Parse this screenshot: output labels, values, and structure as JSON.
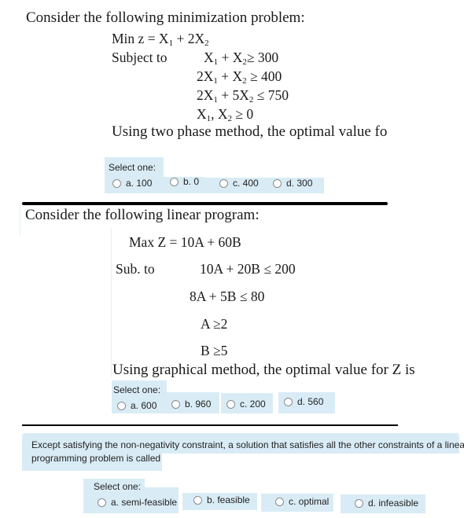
{
  "questions": [
    {
      "intro": "Consider the following minimization problem:",
      "objective": {
        "prefix": "Min z = X",
        "s1": "1",
        "mid": " + 2X",
        "s2": "2"
      },
      "subject_to_label": "Subject to",
      "constraints": [
        {
          "a": "X",
          "s1": "1",
          "b": " + X",
          "s2": "2",
          "c": "≥  300"
        },
        {
          "a": "2X",
          "s1": "1",
          "b": " + X",
          "s2": "2",
          "c": " ≥  400"
        },
        {
          "a": "2X",
          "s1": "1",
          "b": " + 5X",
          "s2": "2",
          "c": " ≤  750"
        },
        {
          "a": "X",
          "s1": "1",
          "b": ", X",
          "s2": "2",
          "c": " ≥ 0"
        }
      ],
      "prompt": "Using two phase method, the optimal value fo",
      "select_label": "Select one:",
      "options": [
        "a. 100",
        "b. 0",
        "c. 400",
        "d. 300"
      ]
    },
    {
      "intro": "Consider the following linear program:",
      "objective": "Max   Z = 10A + 60B",
      "subject_to_label": "Sub. to",
      "constraints": [
        "10A +  20B  ≤ 200",
        "8A + 5B    ≤ 80",
        "A ≥2",
        "B ≥5"
      ],
      "prompt": "Using graphical method, the optimal value for Z is",
      "select_label": "Select one:",
      "options": [
        "a. 600",
        "b. 960",
        "c. 200",
        "d. 560"
      ]
    },
    {
      "text_line1": "Except satisfying the non-negativity constraint, a solution that satisfies all the other constraints of a linear",
      "text_line2": "programming problem is called",
      "select_label": "Select one:",
      "options": [
        "a. semi-feasible",
        "b. feasible",
        "c. optimal",
        "d. infeasible"
      ]
    }
  ],
  "colors": {
    "option_bg": "#d9ecf6",
    "divider": "#000000"
  }
}
